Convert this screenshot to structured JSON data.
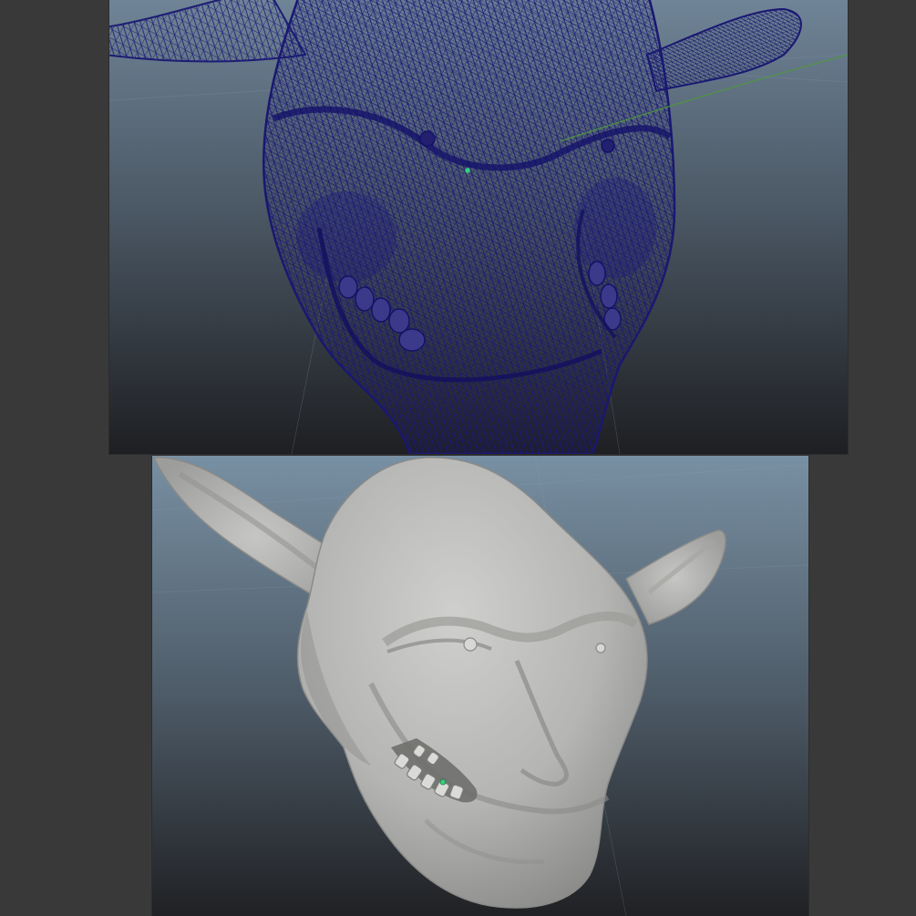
{
  "viewports": [
    {
      "name": "wireframe-viewport",
      "display_mode": "wireframe",
      "mesh_color": "#1f1d7a",
      "background_top": "#6f8497",
      "background_bottom": "#1e1f22"
    },
    {
      "name": "shaded-viewport",
      "display_mode": "smooth-shaded",
      "mesh_color": "#b9b9b7",
      "background_top": "#7890a3",
      "background_bottom": "#202124"
    }
  ],
  "colors": {
    "app_background": "#393939",
    "selection_highlight": "#33d17a",
    "manipulator_line": "#4e9a3a"
  },
  "icons": [
    "pivot-point-icon",
    "manipulator-handle-icon"
  ]
}
